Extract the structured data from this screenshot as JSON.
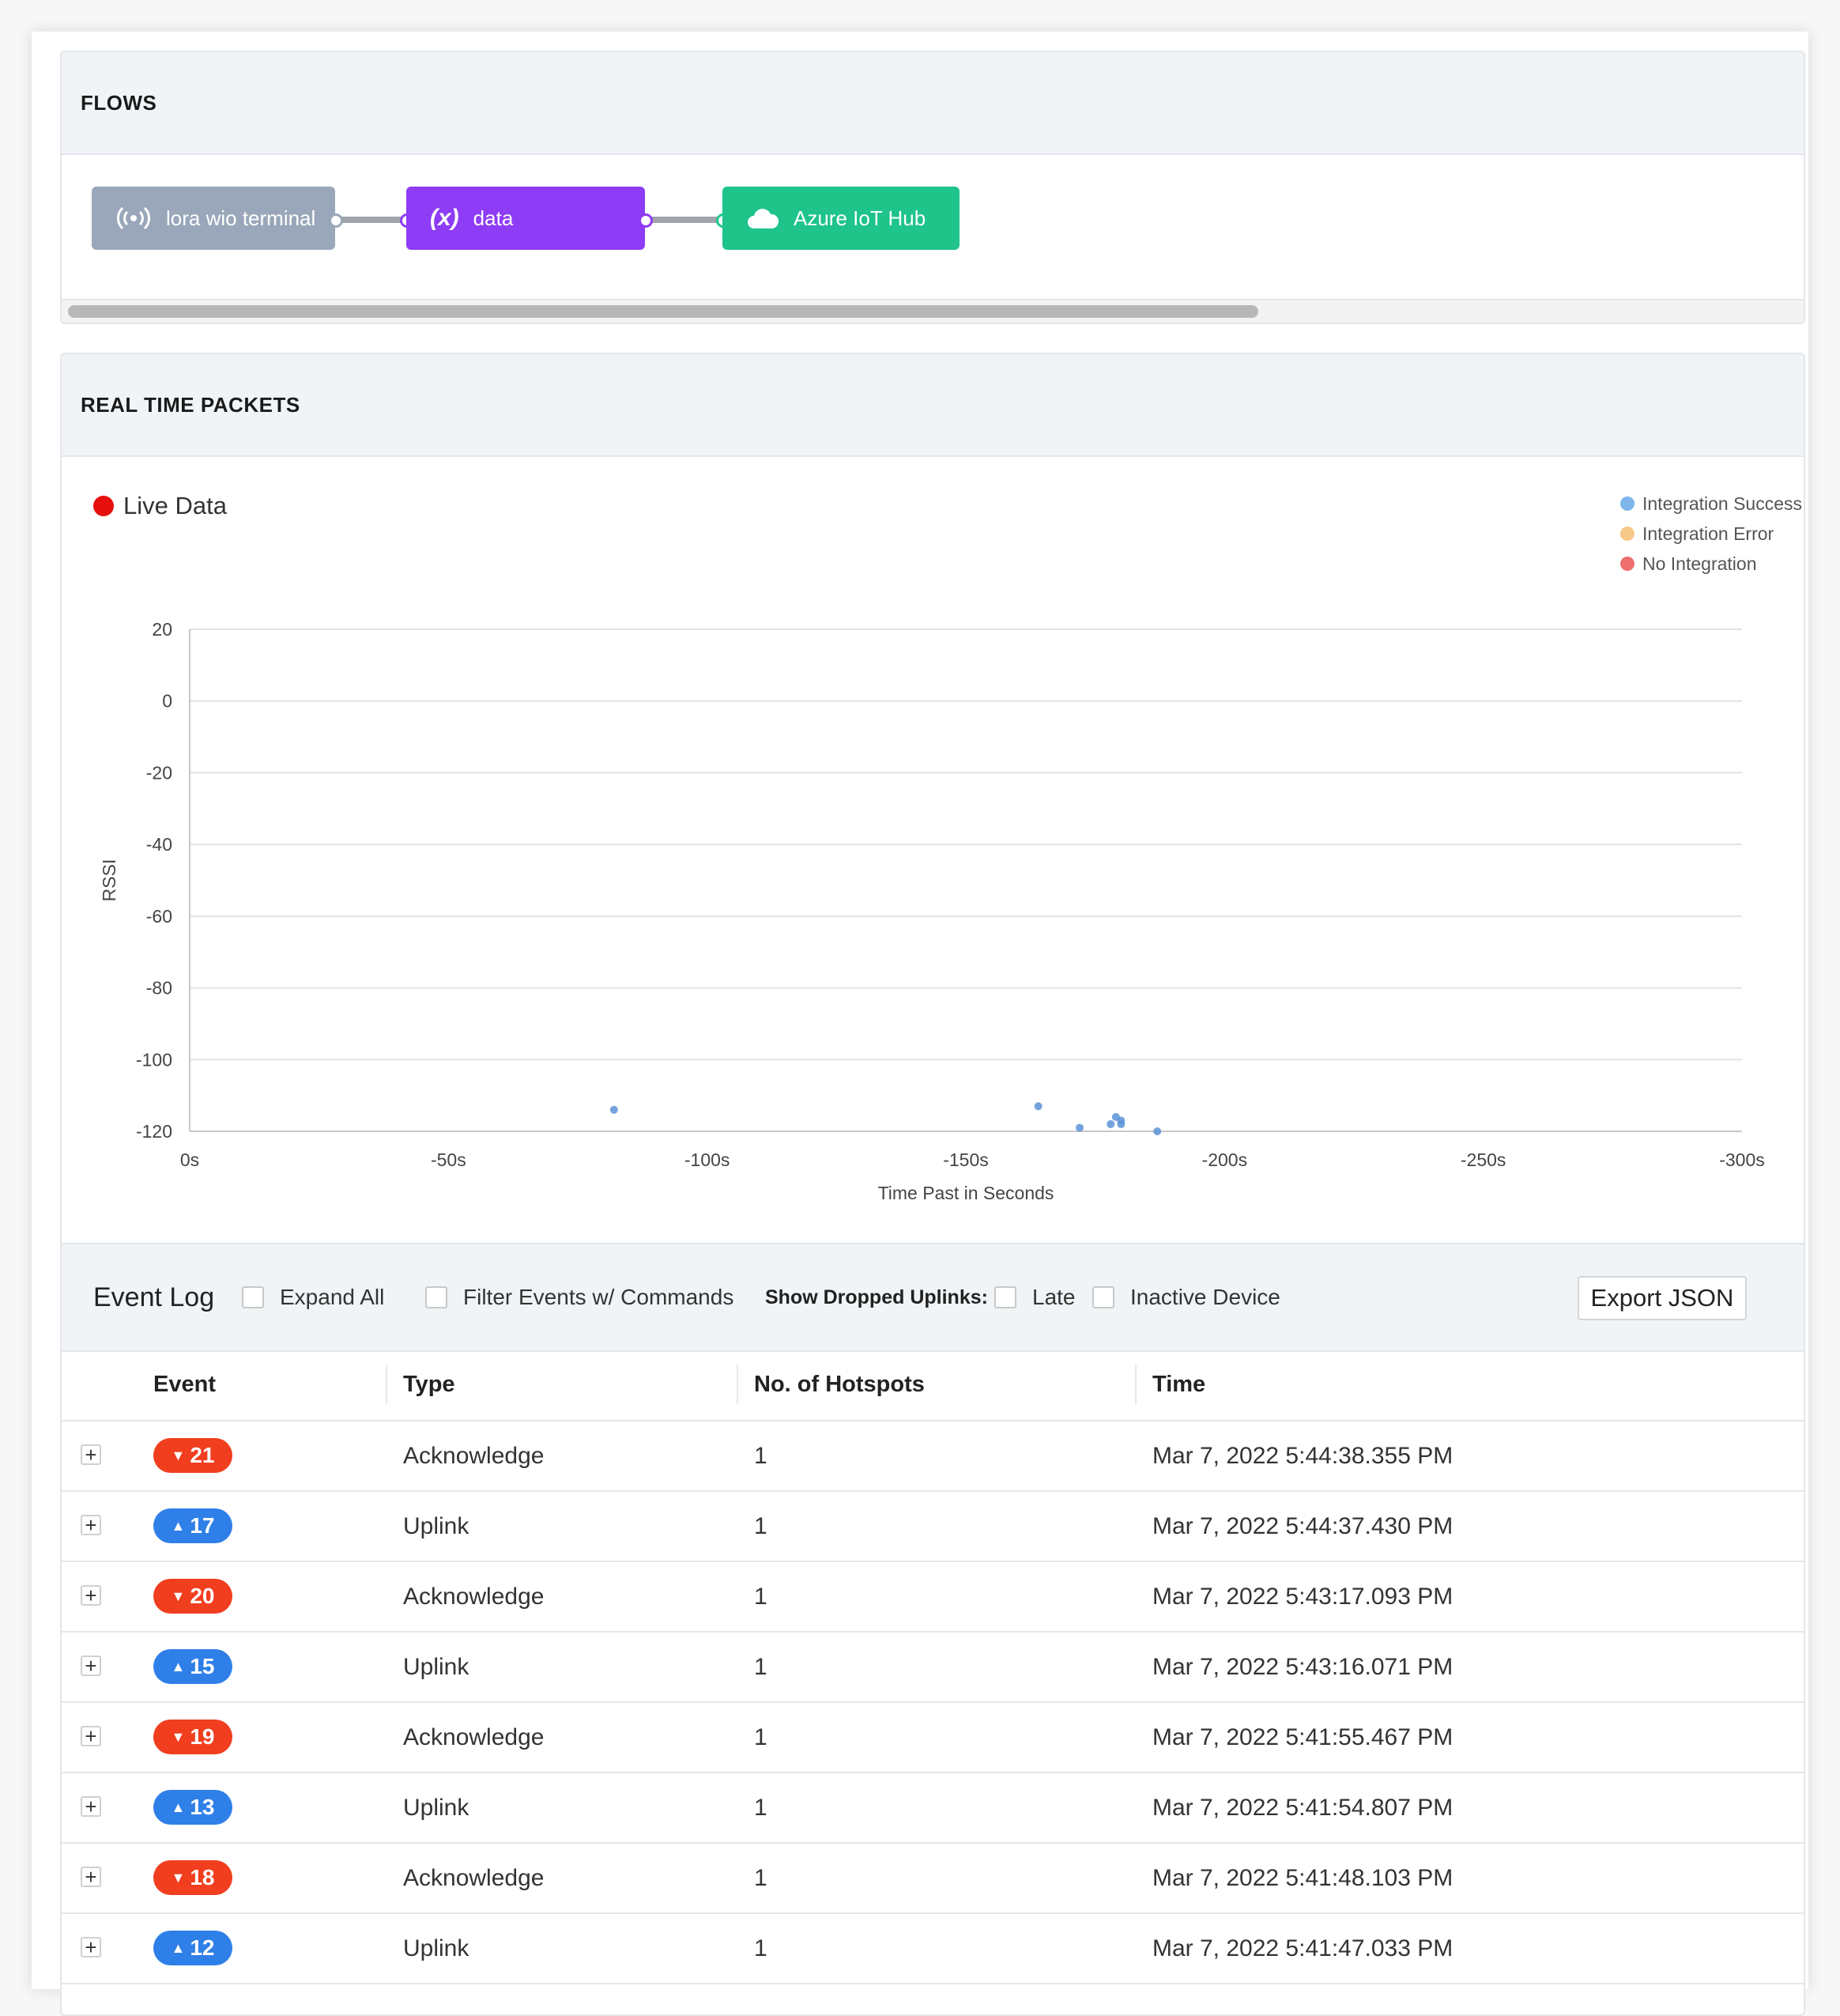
{
  "flows": {
    "title": "FLOWS",
    "nodes": [
      {
        "label": "lora wio terminal",
        "icon": "broadcast-icon",
        "color": "#9aa7ba"
      },
      {
        "label": "data",
        "icon": "function-icon",
        "color": "#8e3cf5"
      },
      {
        "label": "Azure IoT Hub",
        "icon": "cloud-icon",
        "color": "#1ec48a"
      }
    ]
  },
  "packets": {
    "title": "REAL TIME PACKETS",
    "live_label": "Live Data",
    "legend": [
      {
        "label": "Integration Success",
        "color": "#7eb6ec"
      },
      {
        "label": "Integration Error",
        "color": "#f7c889"
      },
      {
        "label": "No Integration",
        "color": "#ee6f6d"
      }
    ]
  },
  "chart_data": {
    "type": "scatter",
    "xlabel": "Time Past in Seconds",
    "ylabel": "RSSI",
    "xlim": [
      0,
      -300
    ],
    "ylim": [
      -120,
      20
    ],
    "x_ticks": [
      "0s",
      "-50s",
      "-100s",
      "-150s",
      "-200s",
      "-250s",
      "-300s"
    ],
    "y_ticks": [
      "20",
      "0",
      "-20",
      "-40",
      "-60",
      "-80",
      "-100",
      "-120"
    ],
    "grid": true,
    "legend_position": "top-right",
    "series": [
      {
        "name": "Integration Success",
        "color": "#5b93d6",
        "points": [
          {
            "x": -82,
            "y": -114
          },
          {
            "x": -164,
            "y": -113
          },
          {
            "x": -172,
            "y": -119
          },
          {
            "x": -179,
            "y": -116
          },
          {
            "x": -180,
            "y": -117
          },
          {
            "x": -180,
            "y": -118
          },
          {
            "x": -178,
            "y": -118
          },
          {
            "x": -187,
            "y": -120
          }
        ]
      }
    ]
  },
  "event_log": {
    "title": "Event Log",
    "expand_all": "Expand All",
    "filter_commands": "Filter Events w/ Commands",
    "show_dropped": "Show Dropped Uplinks:",
    "late": "Late",
    "inactive_device": "Inactive Device",
    "export": "Export JSON",
    "columns": [
      "Event",
      "Type",
      "No. of Hotspots",
      "Time"
    ],
    "rows": [
      {
        "event": "21",
        "direction": "down",
        "type": "Acknowledge",
        "hotspots": "1",
        "time": "Mar 7, 2022 5:44:38.355 PM"
      },
      {
        "event": "17",
        "direction": "up",
        "type": "Uplink",
        "hotspots": "1",
        "time": "Mar 7, 2022 5:44:37.430 PM"
      },
      {
        "event": "20",
        "direction": "down",
        "type": "Acknowledge",
        "hotspots": "1",
        "time": "Mar 7, 2022 5:43:17.093 PM"
      },
      {
        "event": "15",
        "direction": "up",
        "type": "Uplink",
        "hotspots": "1",
        "time": "Mar 7, 2022 5:43:16.071 PM"
      },
      {
        "event": "19",
        "direction": "down",
        "type": "Acknowledge",
        "hotspots": "1",
        "time": "Mar 7, 2022 5:41:55.467 PM"
      },
      {
        "event": "13",
        "direction": "up",
        "type": "Uplink",
        "hotspots": "1",
        "time": "Mar 7, 2022 5:41:54.807 PM"
      },
      {
        "event": "18",
        "direction": "down",
        "type": "Acknowledge",
        "hotspots": "1",
        "time": "Mar 7, 2022 5:41:48.103 PM"
      },
      {
        "event": "12",
        "direction": "up",
        "type": "Uplink",
        "hotspots": "1",
        "time": "Mar 7, 2022 5:41:47.033 PM"
      }
    ],
    "badge_colors": {
      "down": "#f03e1f",
      "up": "#2f7fe8"
    }
  }
}
